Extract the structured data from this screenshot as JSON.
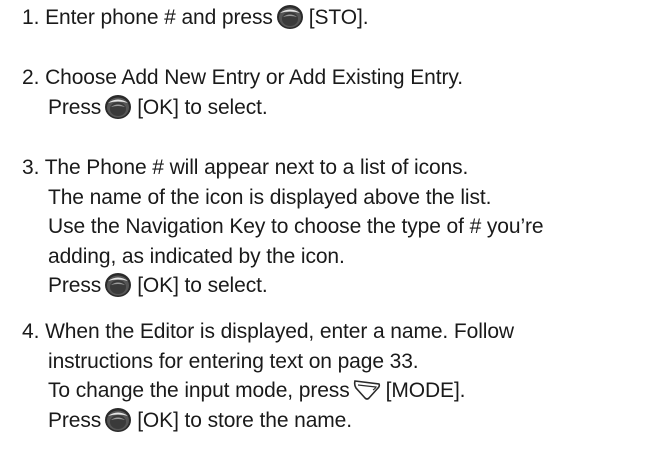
{
  "steps": [
    {
      "number": "1.",
      "lines": [
        {
          "before": "Enter phone # and press",
          "icon": "center-ok-key-icon",
          "after": "[STO]."
        }
      ]
    },
    {
      "number": "2.",
      "lines": [
        {
          "text": "Choose Add New Entry or Add Existing Entry."
        },
        {
          "before": "Press",
          "icon": "center-ok-key-icon",
          "after": "[OK] to select."
        }
      ]
    },
    {
      "number": "3.",
      "lines": [
        {
          "text": "The Phone # will appear next to a list of icons."
        },
        {
          "text": "The name of the icon is displayed above the list."
        },
        {
          "text": "Use the Navigation Key to choose the type of # you’re"
        },
        {
          "text": "adding, as indicated by the icon."
        },
        {
          "before": "Press",
          "icon": "center-ok-key-icon",
          "after": "[OK] to select."
        }
      ]
    },
    {
      "number": "4.",
      "lines": [
        {
          "text": "When the Editor is displayed, enter a name. Follow"
        },
        {
          "text": "instructions for entering text on page 33."
        },
        {
          "before": "To change the input mode, press",
          "icon": "right-soft-key-icon",
          "after": "[MODE]."
        },
        {
          "before": "Press",
          "icon": "center-ok-key-icon",
          "after": "[OK] to store the name."
        }
      ]
    }
  ],
  "colors": {
    "text": "#1a1a1a",
    "icon_dark": "#2a2a2a",
    "icon_light": "#e6e6e6",
    "background": "#ffffff"
  }
}
